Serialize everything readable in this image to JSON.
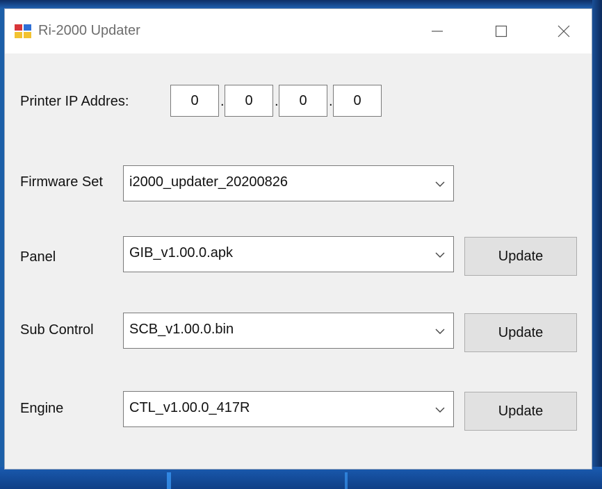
{
  "window": {
    "title": "Ri-2000 Updater"
  },
  "titlebar_icons": {
    "minimize": "minimize-icon",
    "maximize": "maximize-icon",
    "close": "close-icon"
  },
  "ip": {
    "label": "Printer IP Addres:",
    "octets": [
      "0",
      "0",
      "0",
      "0"
    ],
    "separator": "."
  },
  "firmware_set": {
    "label": "Firmware Set",
    "value": "i2000_updater_20200826"
  },
  "panel": {
    "label": "Panel",
    "value": "GIB_v1.00.0.apk",
    "button": "Update"
  },
  "sub_control": {
    "label": "Sub Control",
    "value": "SCB_v1.00.0.bin",
    "button": "Update"
  },
  "engine": {
    "label": "Engine",
    "value": "CTL_v1.00.0_417R",
    "button": "Update"
  }
}
